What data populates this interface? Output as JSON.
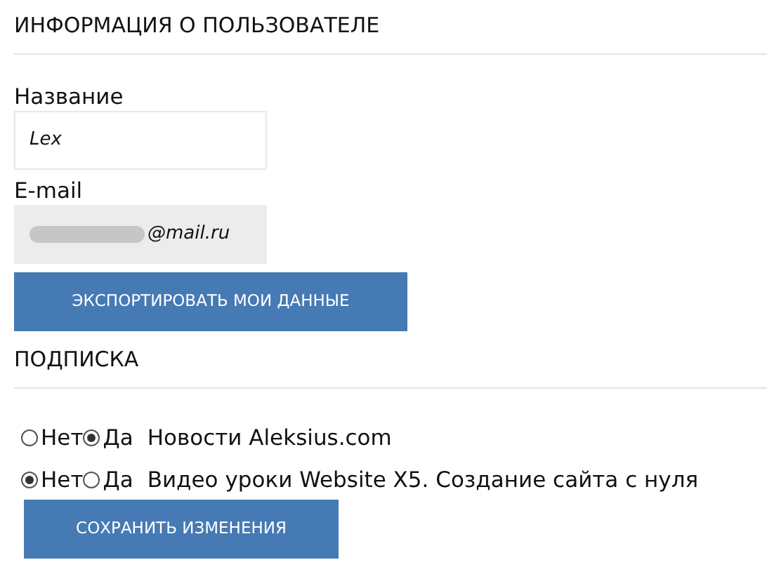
{
  "user_info": {
    "heading": "ИНФОРМАЦИЯ О ПОЛЬЗОВАТЕЛЕ",
    "fields": [
      {
        "label": "Название",
        "value": "Lex",
        "kind": "text"
      },
      {
        "label": "E-mail",
        "value": "@mail.ru",
        "kind": "redacted"
      }
    ],
    "export_button": "ЭКСПОРТИРОВАТЬ МОИ ДАННЫЕ"
  },
  "subscription": {
    "heading": "ПОДПИСКА",
    "items": [
      {
        "title": "Новости Aleksius.com",
        "options": [
          {
            "label": "Нет",
            "selected": false
          },
          {
            "label": "Да",
            "selected": true
          }
        ]
      },
      {
        "title": "Видео уроки Website X5. Создание сайта с нуля",
        "options": [
          {
            "label": "Нет",
            "selected": true
          },
          {
            "label": "Да",
            "selected": false
          }
        ]
      }
    ],
    "save_button": "СОХРАНИТЬ ИЗМЕНЕНИЯ"
  }
}
